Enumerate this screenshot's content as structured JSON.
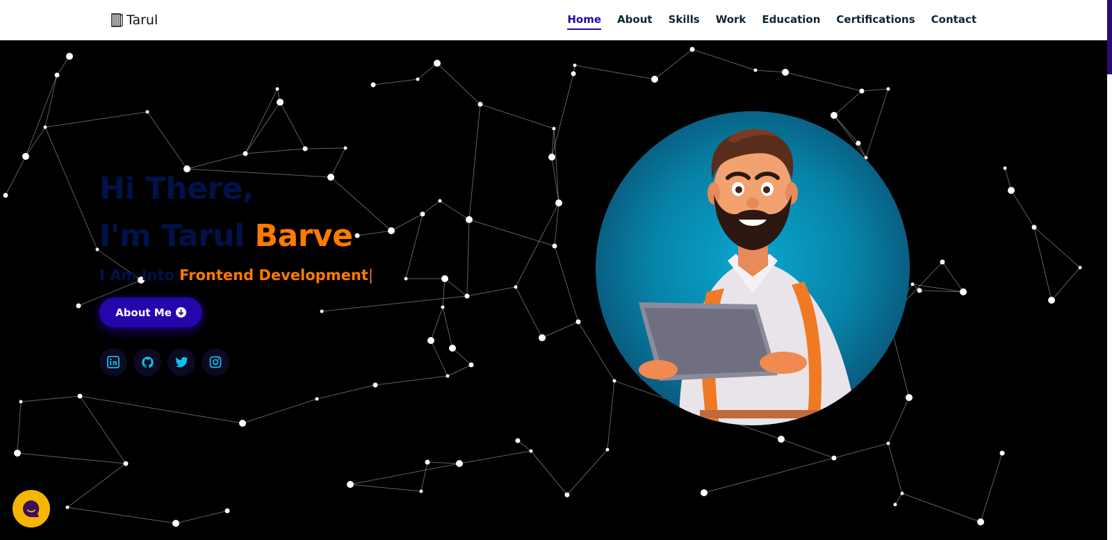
{
  "navbar": {
    "brand": "Tarul",
    "brand_icon": "book-logo-icon",
    "links": [
      {
        "label": "Home",
        "active": true
      },
      {
        "label": "About",
        "active": false
      },
      {
        "label": "Skills",
        "active": false
      },
      {
        "label": "Work",
        "active": false
      },
      {
        "label": "Education",
        "active": false
      },
      {
        "label": "Certifications",
        "active": false
      },
      {
        "label": "Contact",
        "active": false
      }
    ]
  },
  "hero": {
    "greeting": "Hi There,",
    "name_first": "I'm Tarul ",
    "name_last": "Barve",
    "role_prefix": "I Am Into ",
    "role_value": "Frontend Development",
    "cursor": "|",
    "button_label": "About Me",
    "button_icon": "arrow-down-circle-icon",
    "socials": [
      "linkedin-icon",
      "github-icon",
      "twitter-icon",
      "instagram-icon"
    ],
    "avatar_icon": "cartoon-developer-avatar"
  },
  "chat": {
    "icon": "chat-bubble-icon"
  },
  "colors": {
    "accent": "#2506ad",
    "orange": "#ff7a00",
    "navy": "#011249",
    "social_icon": "#0bc3e8",
    "chat": "#f7b500"
  }
}
